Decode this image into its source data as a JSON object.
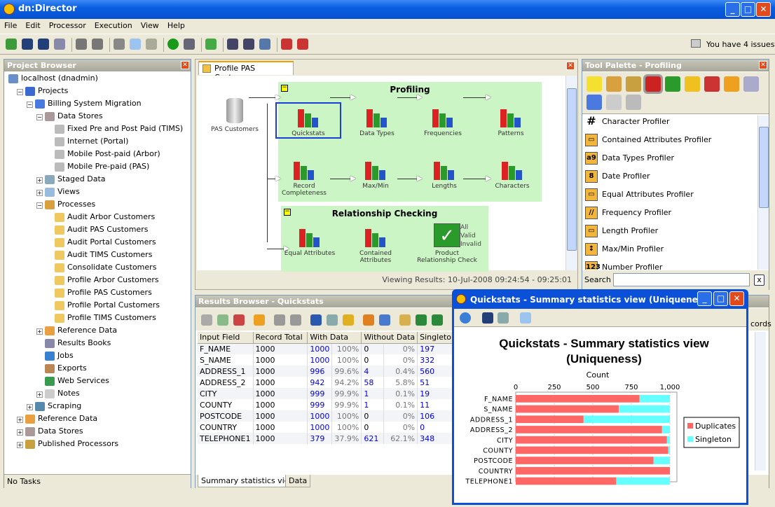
{
  "app": {
    "title": "dn:Director",
    "issues": "You have 4 issues"
  },
  "menu": [
    "File",
    "Edit",
    "Processor",
    "Execution",
    "View",
    "Help"
  ],
  "project_browser": {
    "title": "Project Browser",
    "footer": "No Tasks",
    "tree": [
      {
        "label": "localhost (dnadmin)",
        "level": 0,
        "icon": "server-icon"
      },
      {
        "label": "Projects",
        "level": 1,
        "icon": "projects-icon",
        "exp": "-"
      },
      {
        "label": "Billing System Migration",
        "level": 2,
        "icon": "project-icon",
        "exp": "-"
      },
      {
        "label": "Data Stores",
        "level": 3,
        "icon": "data-stores-icon",
        "exp": "-"
      },
      {
        "label": "Fixed Pre and Post Paid (TIMS)",
        "level": 4,
        "icon": "database-icon"
      },
      {
        "label": "Internet (Portal)",
        "level": 4,
        "icon": "database-icon"
      },
      {
        "label": "Mobile Post-paid (Arbor)",
        "level": 4,
        "icon": "database-icon"
      },
      {
        "label": "Mobile Pre-paid (PAS)",
        "level": 4,
        "icon": "database-icon"
      },
      {
        "label": "Staged Data",
        "level": 3,
        "icon": "staged-data-icon",
        "exp": "+"
      },
      {
        "label": "Views",
        "level": 3,
        "icon": "views-icon",
        "exp": "+"
      },
      {
        "label": "Processes",
        "level": 3,
        "icon": "processes-icon",
        "exp": "-"
      },
      {
        "label": "Audit Arbor Customers",
        "level": 4,
        "icon": "process-icon"
      },
      {
        "label": "Audit PAS Customers",
        "level": 4,
        "icon": "process-icon"
      },
      {
        "label": "Audit Portal Customers",
        "level": 4,
        "icon": "process-icon"
      },
      {
        "label": "Audit TIMS Customers",
        "level": 4,
        "icon": "process-icon"
      },
      {
        "label": "Consolidate Customers",
        "level": 4,
        "icon": "process-icon"
      },
      {
        "label": "Profile Arbor Customers",
        "level": 4,
        "icon": "process-icon"
      },
      {
        "label": "Profile PAS Customers",
        "level": 4,
        "icon": "process-icon"
      },
      {
        "label": "Profile Portal Customers",
        "level": 4,
        "icon": "process-icon"
      },
      {
        "label": "Profile TIMS Customers",
        "level": 4,
        "icon": "process-icon"
      },
      {
        "label": "Reference Data",
        "level": 3,
        "icon": "reference-data-icon",
        "exp": "+"
      },
      {
        "label": "Results Books",
        "level": 3,
        "icon": "results-books-icon"
      },
      {
        "label": "Jobs",
        "level": 3,
        "icon": "jobs-icon"
      },
      {
        "label": "Exports",
        "level": 3,
        "icon": "exports-icon"
      },
      {
        "label": "Web Services",
        "level": 3,
        "icon": "web-services-icon"
      },
      {
        "label": "Notes",
        "level": 3,
        "icon": "notes-icon",
        "exp": "+"
      },
      {
        "label": "Scraping",
        "level": 2,
        "icon": "scraping-icon",
        "exp": "+"
      },
      {
        "label": "Reference Data",
        "level": 1,
        "icon": "reference-data-icon",
        "exp": "+"
      },
      {
        "label": "Data Stores",
        "level": 1,
        "icon": "data-stores-icon",
        "exp": "+"
      },
      {
        "label": "Published Processors",
        "level": 1,
        "icon": "published-processors-icon",
        "exp": "+"
      }
    ]
  },
  "editor": {
    "tab": "Profile PAS Customers",
    "status": "Viewing Results: 10-Jul-2008 09:24:54 - 09:25:01",
    "source": "PAS Customers",
    "groups": [
      {
        "title": "Profiling"
      },
      {
        "title": "Relationship Checking"
      }
    ],
    "nodes": [
      "Quickstats",
      "Data Types",
      "Frequencies",
      "Patterns",
      "Record Completeness",
      "Max/Min",
      "Lengths",
      "Characters",
      "Equal Attributes",
      "Contained Attributes",
      "Product Relationship Check"
    ],
    "outputs": [
      "All",
      "Valid",
      "Invalid"
    ]
  },
  "palette": {
    "title": "Tool Palette - Profiling",
    "search_label": "Search",
    "search_value": "",
    "clear": "x",
    "items": [
      {
        "label": "Character Profiler",
        "glyph": "#"
      },
      {
        "label": "Contained Attributes Profiler",
        "glyph": "▭"
      },
      {
        "label": "Data Types Profiler",
        "glyph": "a9"
      },
      {
        "label": "Date Profiler",
        "glyph": "8"
      },
      {
        "label": "Equal Attributes Profiler",
        "glyph": "▭"
      },
      {
        "label": "Frequency Profiler",
        "glyph": "//"
      },
      {
        "label": "Length Profiler",
        "glyph": "▭"
      },
      {
        "label": "Max/Min Profiler",
        "glyph": "↕"
      },
      {
        "label": "Number Profiler",
        "glyph": "123"
      }
    ]
  },
  "results": {
    "title": "Results Browser - Quickstats",
    "right_text": "cords",
    "columns": [
      "Input Field",
      "Record Total",
      "With Data",
      "Without Data",
      "Singleto"
    ],
    "rows": [
      [
        "F_NAME",
        "1000",
        "1000",
        "100%",
        "0",
        "0%",
        "197"
      ],
      [
        "S_NAME",
        "1000",
        "1000",
        "100%",
        "0",
        "0%",
        "332"
      ],
      [
        "ADDRESS_1",
        "1000",
        "996",
        "99.6%",
        "4",
        "0.4%",
        "560"
      ],
      [
        "ADDRESS_2",
        "1000",
        "942",
        "94.2%",
        "58",
        "5.8%",
        "51"
      ],
      [
        "CITY",
        "1000",
        "999",
        "99.9%",
        "1",
        "0.1%",
        "19"
      ],
      [
        "COUNTY",
        "1000",
        "999",
        "99.9%",
        "1",
        "0.1%",
        "11"
      ],
      [
        "POSTCODE",
        "1000",
        "1000",
        "100%",
        "0",
        "0%",
        "106"
      ],
      [
        "COUNTRY",
        "1000",
        "1000",
        "100%",
        "0",
        "0%",
        "0"
      ],
      [
        "TELEPHONE1",
        "1000",
        "379",
        "37.9%",
        "621",
        "62.1%",
        "348"
      ]
    ],
    "tabs": [
      "Summary statistics view",
      "Data"
    ]
  },
  "popup": {
    "title": "Quickstats - Summary statistics view (Uniqueness)"
  },
  "chart_data": {
    "type": "bar",
    "orientation": "horizontal",
    "stacked": true,
    "title": "Quickstats - Summary statistics view (Uniqueness)",
    "xlabel": "Count",
    "ylabel": "",
    "xlim": [
      0,
      1000
    ],
    "xticks": [
      "0",
      "250",
      "500",
      "750",
      "1,000"
    ],
    "grid": true,
    "legend": "right",
    "categories": [
      "F_NAME",
      "S_NAME",
      "ADDRESS_1",
      "ADDRESS_2",
      "CITY",
      "COUNTY",
      "POSTCODE",
      "COUNTRY",
      "TELEPHONE1"
    ],
    "series": [
      {
        "name": "Duplicates",
        "color": "#ff6666",
        "values": [
          803,
          668,
          440,
          949,
          981,
          989,
          894,
          1000,
          652
        ]
      },
      {
        "name": "Singleton",
        "color": "#66ffff",
        "values": [
          197,
          332,
          560,
          51,
          19,
          11,
          106,
          0,
          348
        ]
      }
    ]
  }
}
